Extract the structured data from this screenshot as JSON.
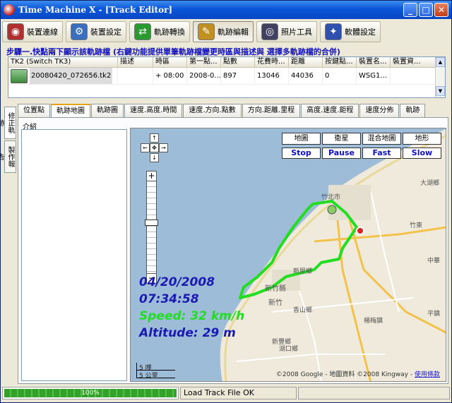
{
  "window": {
    "title": "Time Machine X - [Track Editor]"
  },
  "toolbar": {
    "buttons": [
      {
        "label": "裝置連線",
        "icon": "device-connect-icon",
        "color": "#b03030"
      },
      {
        "label": "裝置設定",
        "icon": "device-settings-icon",
        "color": "#3a6fc0"
      },
      {
        "label": "軌跡轉換",
        "icon": "track-convert-icon",
        "color": "#2a9a30"
      },
      {
        "label": "軌跡編輯",
        "icon": "track-edit-icon",
        "color": "#c09020"
      },
      {
        "label": "照片工具",
        "icon": "camera-icon",
        "color": "#404060"
      },
      {
        "label": "軟體設定",
        "icon": "software-settings-icon",
        "color": "#3050b0"
      }
    ]
  },
  "step_label": "步驟一.快點兩下顯示該軌跡檔 (右鍵功能提供單筆軌跡檔變更時區與描述與 選擇多軌跡檔的合併)",
  "track_table": {
    "headers": [
      "TK2 (Switch TK3)",
      "描述",
      "時區",
      "第一點...",
      "點數",
      "花費時...",
      "距離",
      "按鍵點...",
      "裝置名...",
      "裝置資..."
    ],
    "rows": [
      [
        "20080420_072656.tk2",
        "",
        "+ 08:00",
        "2008-0...",
        "897",
        "13046",
        "44036",
        "0",
        "WSG1...",
        ""
      ]
    ]
  },
  "side_tabs": [
    "修正軌跡",
    "製作報告"
  ],
  "tabs": [
    "位置點",
    "軌跡地圖",
    "軌跡圖",
    "速度.高度.時間",
    "速度.方向.點數",
    "方向.距離.里程",
    "高度.速度.鉅程",
    "速度分佈",
    "軌跡"
  ],
  "active_tab": 1,
  "intro_label": "介紹",
  "map": {
    "type_buttons": [
      "地圖",
      "衛星",
      "混合地圖",
      "地形"
    ],
    "play_buttons": [
      "Stop",
      "Pause",
      "Fast",
      "Slow"
    ],
    "date": "04/20/2008",
    "time": "07:34:58",
    "speed": "Speed: 32 km/h",
    "altitude": "Altitude: 29 m",
    "scale_top": "5 哩",
    "scale_bottom": "5 公里",
    "copyright": "©2008 Google - 地圖資料 ©2008 Kingway -",
    "terms": "使用條款",
    "labels": [
      "竹北市",
      "新豐鄉",
      "湖口鄉",
      "新竹縣",
      "新竹",
      "香山鄉",
      "大湖鄉",
      "竹東",
      "中華",
      "楊梅鎮",
      "平鎮",
      "新屋鄉"
    ],
    "colors": {
      "track": "#22dd22",
      "date": "#1a1ab0",
      "speed": "#22dd22",
      "altitude": "#1a1ab0"
    }
  },
  "status": {
    "progress": "100%",
    "progress_fraction": 1.0,
    "message": "Load Track File OK"
  }
}
